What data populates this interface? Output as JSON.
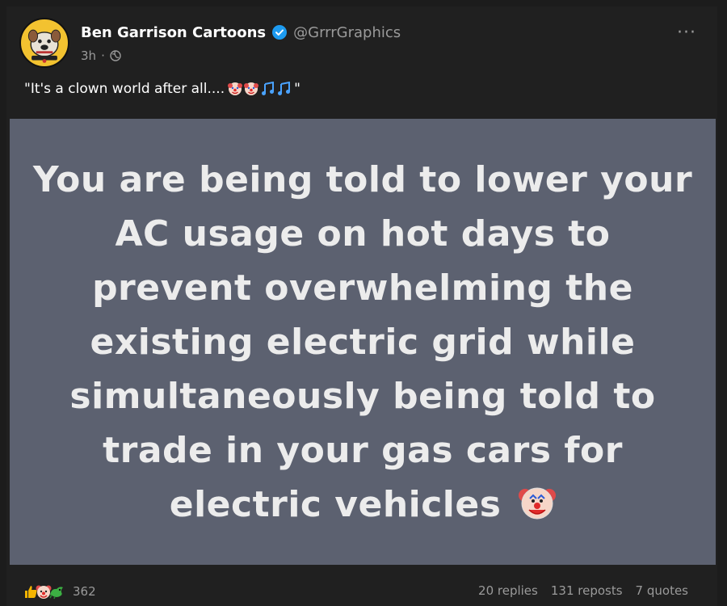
{
  "post": {
    "author": {
      "display_name": "Ben Garrison Cartoons",
      "handle": "@GrrrGraphics",
      "avatar_icon": "bulldog-avatar-icon",
      "verified_icon": "verified-badge-icon"
    },
    "time": "3h",
    "separator": "·",
    "visibility_icon": "globe-icon",
    "more_label": "···",
    "text": "\"It's a clown world after all....",
    "text_suffix": "\"",
    "text_emojis": [
      "clown-face-icon",
      "clown-face-icon",
      "music-note-icon",
      "music-note-icon"
    ],
    "image_text": "You are being told to lower your AC usage on hot days to prevent overwhelming the existing electric grid while simultaneously being told to trade in your gas cars for electric vehicles",
    "colors": {
      "background": "#1c1c1c",
      "card": "#202020",
      "image_bg": "#5c6170",
      "verified": "#1d9bf0",
      "muted": "#9a9a9a"
    }
  },
  "footer": {
    "reaction_icons": [
      "thumbs-up-icon",
      "clown-face-icon",
      "dragon-icon"
    ],
    "reaction_count": "362",
    "replies": "20 replies",
    "reposts": "131 reposts",
    "quotes": "7 quotes"
  }
}
